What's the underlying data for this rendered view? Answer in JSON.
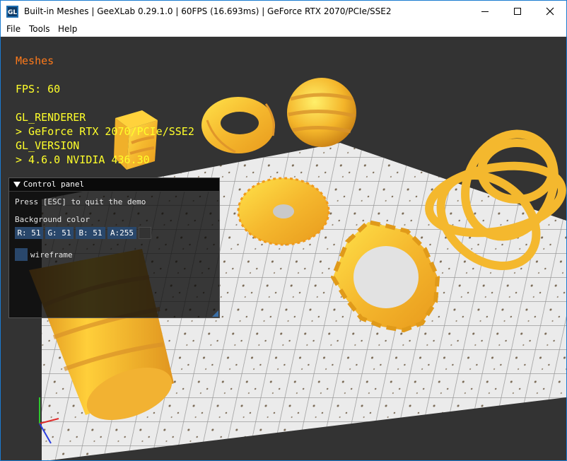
{
  "window": {
    "title": "Built-in Meshes | GeeXLab 0.29.1.0 | 60FPS (16.693ms) | GeForce RTX 2070/PCIe/SSE2",
    "icon": "geexlab-logo-icon",
    "controls": [
      "minimize-icon",
      "maximize-icon",
      "close-icon"
    ]
  },
  "menu": {
    "items": [
      "File",
      "Tools",
      "Help"
    ]
  },
  "hud": {
    "title": "Meshes",
    "fps": "FPS: 60",
    "renderer_label": "GL_RENDERER",
    "renderer_value": "> GeForce RTX 2070/PCIe/SSE2",
    "version_label": "GL_VERSION",
    "version_value": "> 4.6.0 NVIDIA 436.30",
    "colors": {
      "title": "#ff7a1a",
      "text": "#ffff2a"
    }
  },
  "control_panel": {
    "title": "Control panel",
    "quit_hint": "Press [ESC] to quit the demo",
    "bg_label": "Background color",
    "channels": {
      "r": "R: 51",
      "g": "G: 51",
      "b": "B: 51",
      "a": "A:255"
    },
    "wireframe_label": "wireframe",
    "wireframe_checked": false
  },
  "scene": {
    "background": "#333333",
    "meshes": [
      "cube",
      "torus",
      "sphere",
      "disc",
      "gear",
      "torus-knot",
      "cylinder",
      "floor-plane",
      "axis-gizmo"
    ]
  }
}
